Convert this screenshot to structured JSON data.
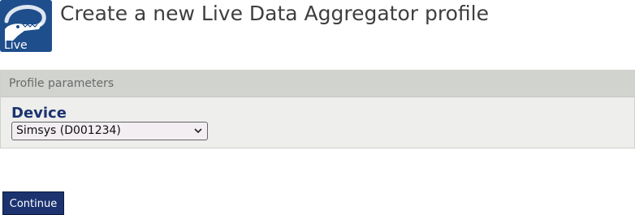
{
  "header": {
    "logo_text": "Live",
    "title": "Create a new Live Data Aggregator profile"
  },
  "panel": {
    "header_label": "Profile parameters",
    "device_label": "Device",
    "device_selected": "Simsys (D001234)"
  },
  "actions": {
    "continue_label": "Continue"
  },
  "icons": {
    "logo": "crocodile-logo-icon",
    "dropdown": "chevron-down-icon"
  },
  "colors": {
    "brand": "#1c3370",
    "logo_bg": "#1f4e8c"
  }
}
